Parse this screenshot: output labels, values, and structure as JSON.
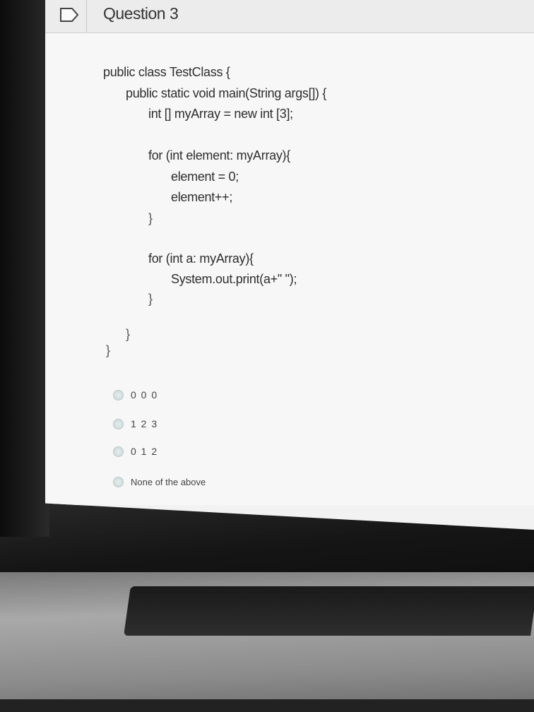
{
  "header": {
    "title": "Question 3",
    "icon": "flag-icon"
  },
  "code": {
    "lines": [
      "public class TestClass {",
      "public static void main(String args[]) {",
      "int [] myArray = new int [3];",
      "for (int element: myArray){",
      "element = 0;",
      "element++;",
      "}",
      "for (int a: myArray){",
      "System.out.print(a+\" \");",
      "}",
      "}",
      "}"
    ]
  },
  "options": [
    {
      "label": "0 0 0"
    },
    {
      "label": "1 2 3"
    },
    {
      "label": "0 1 2"
    },
    {
      "label": "None of the above"
    }
  ],
  "colors": {
    "screen_bg": "#f7f7f7",
    "title_bg": "#ececec",
    "text": "#2e2e2e",
    "bezel": "#151515"
  }
}
